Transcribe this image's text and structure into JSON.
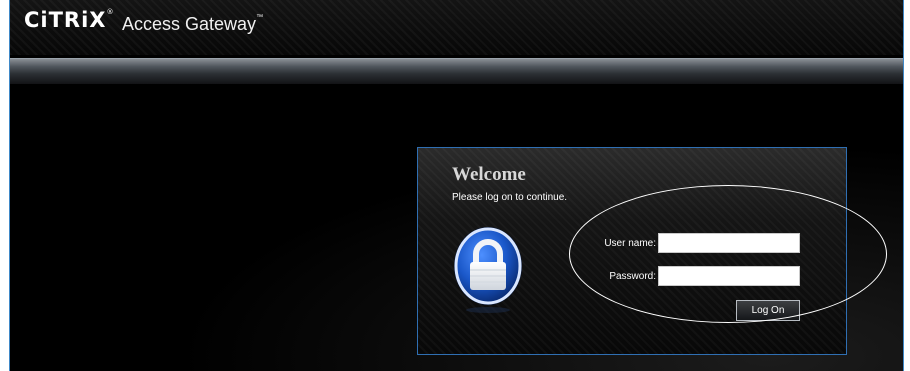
{
  "header": {
    "brand": "CiTRiX",
    "brand_mark": "®",
    "product": "Access Gateway",
    "product_mark": "™"
  },
  "login": {
    "title": "Welcome",
    "subtitle": "Please log on to continue.",
    "username_label": "User name:",
    "username_value": "",
    "password_label": "Password:",
    "password_value": "",
    "logon_label": "Log On"
  },
  "icons": {
    "lock": "padlock-icon"
  },
  "colors": {
    "background": "#000000",
    "frame_border": "#3f88c7",
    "lock_blue": "#1a57c8",
    "panel_border": "#2f6fb3"
  }
}
